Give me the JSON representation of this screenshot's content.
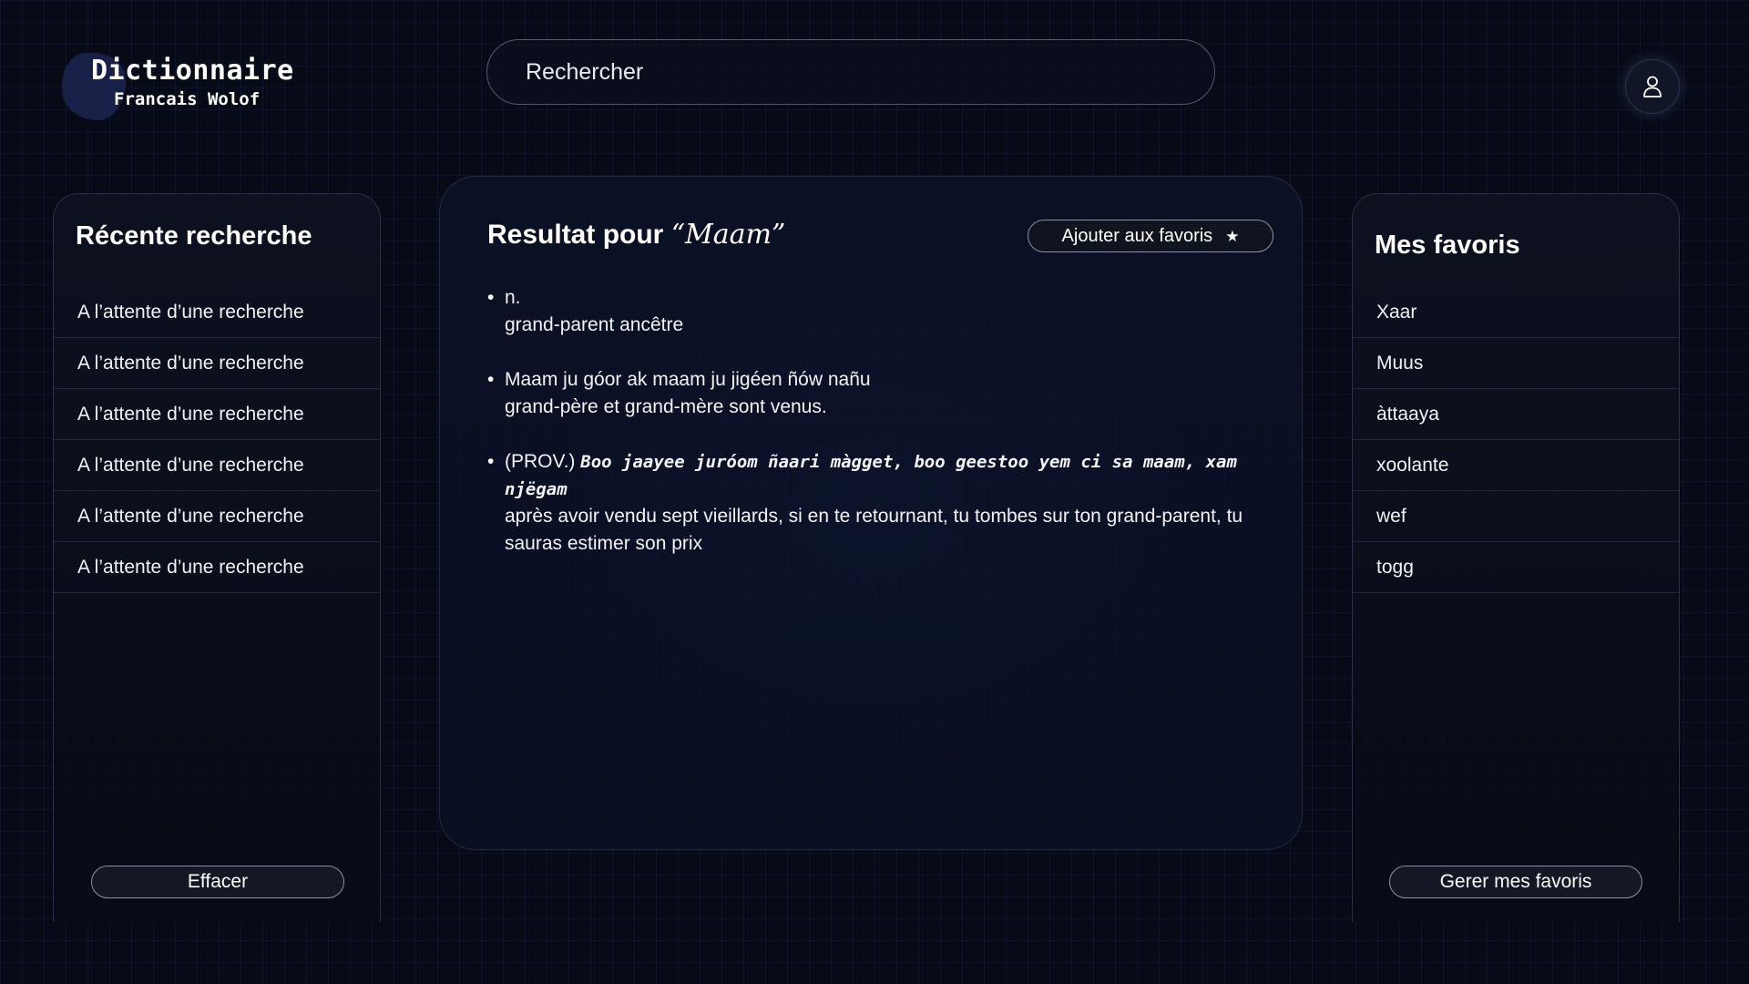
{
  "header": {
    "logo_title": "Dictionnaire",
    "logo_subtitle": "Francais Wolof",
    "search_placeholder": "Rechercher",
    "user_icon": "user-icon"
  },
  "recent": {
    "title": "Récente recherche",
    "items": [
      "A l’attente d’une recherche",
      "A l’attente d’une recherche",
      "A l’attente d’une recherche",
      "A l’attente d’une recherche",
      "A l’attente d’une recherche",
      "A l’attente d’une recherche"
    ],
    "clear_label": "Effacer"
  },
  "result": {
    "title_prefix": "Resultat pour ",
    "term": "“Maam”",
    "favorite_label": "Ajouter aux favoris",
    "favorite_icon": "star-icon",
    "definitions": [
      {
        "source": "n.",
        "translation": "grand-parent ancêtre"
      },
      {
        "source": "Maam ju góor ak maam ju jigéen ñów nañu",
        "translation": "grand-père et grand-mère sont venus."
      },
      {
        "prefix": "(PROV.)",
        "source": "Boo jaayee juróom ñaari màgget, boo geestoo yem ci sa maam, xam njëgam",
        "translation": "après avoir vendu sept vieillards, si en te retournant, tu tombes sur ton grand-parent, tu sauras estimer son prix"
      }
    ]
  },
  "favorites": {
    "title": "Mes favoris",
    "items": [
      "Xaar",
      "Muus",
      "àttaaya",
      "xoolante",
      "wef",
      "togg"
    ],
    "manage_label": "Gerer mes favoris"
  },
  "colors": {
    "background": "#070b18",
    "panel_border": "#2b3144",
    "text": "#ffffff"
  }
}
